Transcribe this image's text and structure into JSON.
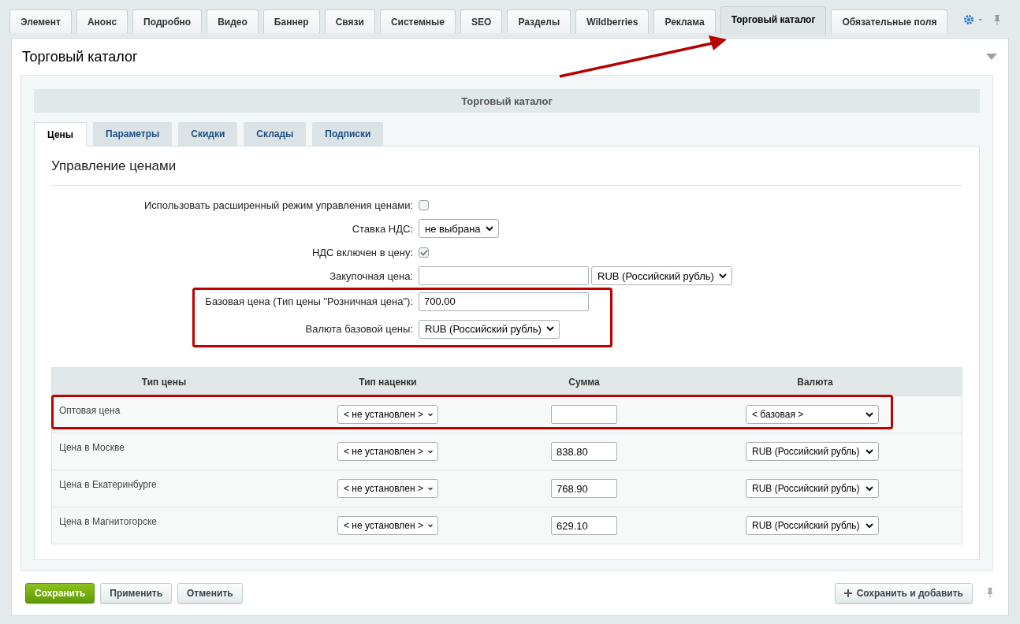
{
  "top_tabs": [
    {
      "label": "Элемент",
      "selected": false
    },
    {
      "label": "Анонс",
      "selected": false
    },
    {
      "label": "Подробно",
      "selected": false
    },
    {
      "label": "Видео",
      "selected": false
    },
    {
      "label": "Баннер",
      "selected": false
    },
    {
      "label": "Связи",
      "selected": false
    },
    {
      "label": "Системные",
      "selected": false
    },
    {
      "label": "SEO",
      "selected": false
    },
    {
      "label": "Разделы",
      "selected": false
    },
    {
      "label": "Wildberries",
      "selected": false
    },
    {
      "label": "Реклама",
      "selected": false
    },
    {
      "label": "Торговый каталог",
      "selected": true
    },
    {
      "label": "Обязательные поля",
      "selected": false
    }
  ],
  "panel": {
    "title": "Торговый каталог",
    "section_header": "Торговый каталог"
  },
  "sub_tabs": [
    {
      "label": "Цены",
      "selected": true
    },
    {
      "label": "Параметры",
      "selected": false
    },
    {
      "label": "Скидки",
      "selected": false
    },
    {
      "label": "Склады",
      "selected": false
    },
    {
      "label": "Подписки",
      "selected": false
    }
  ],
  "heading": "Управление ценами",
  "fields": [
    {
      "kind": "checkbox",
      "label": "Использовать расширенный режим управления ценами:",
      "checked": false
    },
    {
      "kind": "select",
      "label": "Ставка НДС:",
      "value": "не выбрана"
    },
    {
      "kind": "checkbox",
      "label": "НДС включен в цену:",
      "checked": true
    },
    {
      "kind": "input_select",
      "label": "Закупочная цена:",
      "select": "RUB (Российский рубль)"
    },
    {
      "kind": "input",
      "label": "Базовая цена (Тип цены \"Розничная цена\"):",
      "value": "700.00"
    },
    {
      "kind": "select",
      "label": "Валюта базовой цены:",
      "value": "RUB (Российский рубль)"
    }
  ],
  "price_table": {
    "columns": [
      "Тип цены",
      "Тип наценки",
      "Сумма",
      "Валюта"
    ],
    "rows": [
      {
        "price_type": "Оптовая цена",
        "markup_type": "< не установлен >",
        "currency": "< базовая >"
      },
      {
        "price_type": "Цена в Москве",
        "markup_type": "< не установлен >",
        "amount": "838.80",
        "currency": "RUB (Российский рубль)"
      },
      {
        "price_type": "Цена в Екатеринбурге",
        "markup_type": "< не установлен >",
        "amount": "768.90",
        "currency": "RUB (Российский рубль)"
      },
      {
        "price_type": "Цена в Магнитогорске",
        "markup_type": "< не установлен >",
        "amount": "629.10",
        "currency": "RUB (Российский рубль)"
      }
    ]
  },
  "buttons": [
    {
      "label": "Сохранить",
      "kind": "primary"
    },
    {
      "label": "Применить",
      "kind": "default"
    },
    {
      "label": "Отменить",
      "kind": "default"
    },
    {
      "label": "Сохранить и добавить",
      "kind": "add"
    }
  ],
  "annotations": [
    {
      "kind": "arrow"
    },
    {
      "kind": "frame"
    },
    {
      "kind": "frame"
    }
  ]
}
